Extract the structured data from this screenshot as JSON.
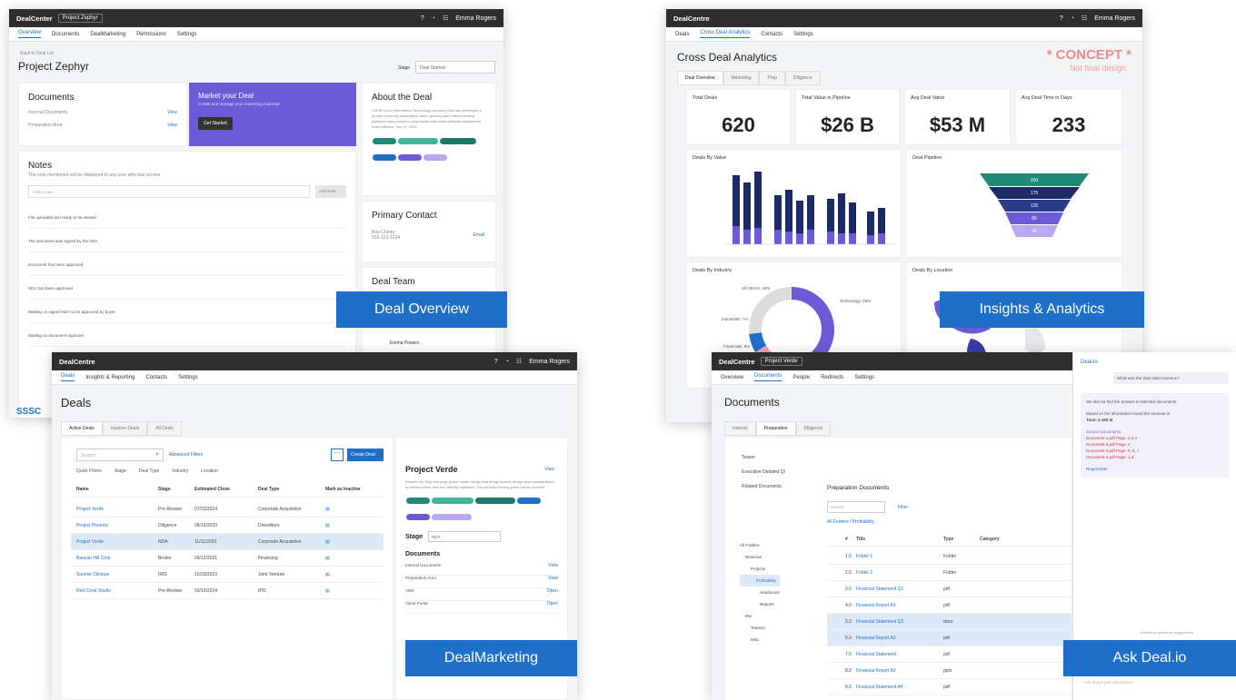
{
  "overview": {
    "brand": "DealCenter",
    "project": "Project Zephyr",
    "user": "Emma Rogers",
    "nav": [
      "Overview",
      "Documents",
      "DealMarketing",
      "Permissions",
      "Settings"
    ],
    "back": "Back to Deal List",
    "title": "Project Zephyr",
    "stage_label": "Stage",
    "stage_value": "Deal Started",
    "documents": {
      "title": "Documents",
      "rows": [
        {
          "name": "Internal Documents",
          "action": "View"
        },
        {
          "name": "Preparation Area",
          "action": "View"
        }
      ]
    },
    "market": {
      "title": "Market your Deal",
      "subtitle": "Create and manage your marketing materials",
      "button": "Get Started"
    },
    "about": {
      "title": "About the Deal",
      "text": "A B2B Cloud Information Technology company that has developed a proven recurring subscription base, growing and market-leading platforms and powerful components that make software deployment more efficient. July 22, 2021."
    },
    "notes": {
      "title": "Notes",
      "subtitle": "The note mentioned will be displayed to any user who has access.",
      "placeholder": "Add a note",
      "button": "Add Note",
      "items": [
        "File uploaded and ready to be viewed",
        "The document was signed by the NDA",
        "Document has been approved",
        "NDA has been approved",
        "Waiting on signed NDA to be approved by buyer",
        "Waiting on document approval"
      ]
    },
    "contact": {
      "title": "Primary Contact",
      "name": "Bria Cluney",
      "phone": "555-123-1234",
      "action": "Email"
    },
    "team": {
      "title": "Deal Team",
      "member": "Emma Powers"
    },
    "footer_logo": "SSSC"
  },
  "analytics": {
    "brand": "DealCentre",
    "nav": [
      "Deals",
      "Cross Deal Analytics",
      "Contacts",
      "Settings"
    ],
    "title": "Cross Deal Analytics",
    "concept": "* CONCEPT *",
    "concept_sub": "Not final design",
    "tabs": [
      "Deal Overview",
      "Marketing",
      "Prep",
      "Diligence"
    ],
    "kpis": [
      {
        "label": "Total Deals",
        "value": "620"
      },
      {
        "label": "Total Value in Pipeline",
        "value": "$26 B"
      },
      {
        "label": "Avg Deal Value",
        "value": "$53 M"
      },
      {
        "label": "Avg Deal Time in Days",
        "value": "233"
      }
    ],
    "deals_by_value": "Deals By Value",
    "pipeline_title": "Deal Pipeline",
    "industry_title": "Deals By Industry",
    "location_title": "Deals By Location",
    "pipeline_values": [
      "200",
      "175",
      "125",
      "80",
      "40"
    ],
    "industry_labels": [
      "All Others: 18%",
      "Technology: 28%",
      "Industrials: 7%",
      "Financials: 9%"
    ]
  },
  "marketing": {
    "brand": "DealCentre",
    "user": "Emma Rogers",
    "nav": [
      "Deals",
      "Insights & Reporting",
      "Contacts",
      "Settings"
    ],
    "title": "Deals",
    "tabs": [
      "Active Deals",
      "Inactive Deals",
      "All Deals"
    ],
    "search_placeholder": "Search",
    "advanced": "Advanced Filters",
    "create": "Create Deal",
    "filters": [
      "Quick Filters",
      "Stage",
      "Deal Type",
      "Industry",
      "Location"
    ],
    "columns": [
      "Name",
      "Stage",
      "Estimated Close",
      "Deal Type",
      "Mark as Inactive"
    ],
    "rows": [
      [
        "Project Verde",
        "Pre-Review",
        "07/23/2024",
        "Corporate Acquisition"
      ],
      [
        "Project Phoenix",
        "Diligence",
        "08/15/2023",
        "Divestiture"
      ],
      [
        "Project Verde",
        "NDA",
        "11/11/2023",
        "Corporate Acquisition"
      ],
      [
        "Banyan Hill Corp",
        "Broker",
        "09/12/2021",
        "Financing"
      ],
      [
        "Sunrise Clinique",
        "IRIS",
        "10/23/2023",
        "Joint Venture"
      ],
      [
        "Red Coral Studio",
        "Pre-Review",
        "03/10/2024",
        "IPO"
      ]
    ],
    "detail": {
      "title": "Project Verde",
      "action": "View",
      "text": "Planned by Stop and prep' green house design that brings sustain design and considerations to infrastructure, and eco-friendly initiatives. The industry leading green house provider.",
      "stage_label": "Stage",
      "stage_value": "NDA",
      "docs_title": "Documents",
      "docs": [
        {
          "name": "Internal Documents",
          "action": "View"
        },
        {
          "name": "Preparation Area",
          "action": "View"
        },
        {
          "name": "VDR",
          "action": "Open"
        },
        {
          "name": "Client Portal",
          "action": "Open"
        }
      ]
    }
  },
  "askdeal": {
    "brand": "DealCentre",
    "project": "Project Verde",
    "nav": [
      "Overview",
      "Documents",
      "People",
      "Redirects",
      "Settings"
    ],
    "title": "Documents",
    "tabs": [
      "Internal",
      "Preparation",
      "Diligence"
    ],
    "tree": [
      "Teaser",
      "Executive Detailed Ql",
      "Related Documents"
    ],
    "folder_title": "Preparation Documents",
    "search_placeholder": "Search",
    "filter": "Filter",
    "breadcrumb": "All Folders / Profitability",
    "columns": [
      "#",
      "Title",
      "Type",
      "Category"
    ],
    "files": [
      [
        "1.0",
        "Folder 1",
        "Folder"
      ],
      [
        "2.0",
        "Folder 2",
        "Folder"
      ],
      [
        "3.0",
        "Financial Statement Q1",
        "pdf"
      ],
      [
        "4.0",
        "Financial Report A1",
        "pdf"
      ],
      [
        "5.0",
        "Financial Statement Q2",
        "docx"
      ],
      [
        "6.0",
        "Financial Report A2",
        "pdf"
      ],
      [
        "7.0",
        "Financial Statement",
        "pdf"
      ],
      [
        "8.0",
        "Financial Report A3",
        "pptx"
      ],
      [
        "9.0",
        "Financial Statement A4",
        "pdf"
      ]
    ],
    "folders": [
      "All Folders",
      "Revenue",
      "Projects",
      "Profitability",
      "Headcount",
      "Reports",
      "EM",
      "Teasers",
      "Misc"
    ],
    "chat": {
      "title": "Deal.io",
      "question": "What was the total sales revenue?",
      "answer_intro": "We did not find the answer in selected documents.",
      "answer_body": "Based on the information found the revenue in",
      "total": "Total: $ 485 M",
      "sources_label": "Source Documents",
      "sources": [
        "Document 1.pdf  Page: 1,2,3",
        "Document 2.pdf  Page: 4",
        "Document 3.pdf  Page: 5, 6, 7",
        "Document 4.pdf  Page: 1,3"
      ],
      "regen": "Regenerate",
      "input_placeholder": "Ask about your documents",
      "note": "Additional questions suggestions"
    }
  },
  "labels": {
    "overview": "Deal Overview",
    "analytics": "Insights & Analytics",
    "marketing": "DealMarketing",
    "askdeal": "Ask Deal.io"
  },
  "colors": {
    "accent": "#1e6fc7",
    "purple": "#6b5bd6",
    "navy": "#1c2a66",
    "teal": "#1f8a75",
    "lilac": "#b7a8ef"
  }
}
